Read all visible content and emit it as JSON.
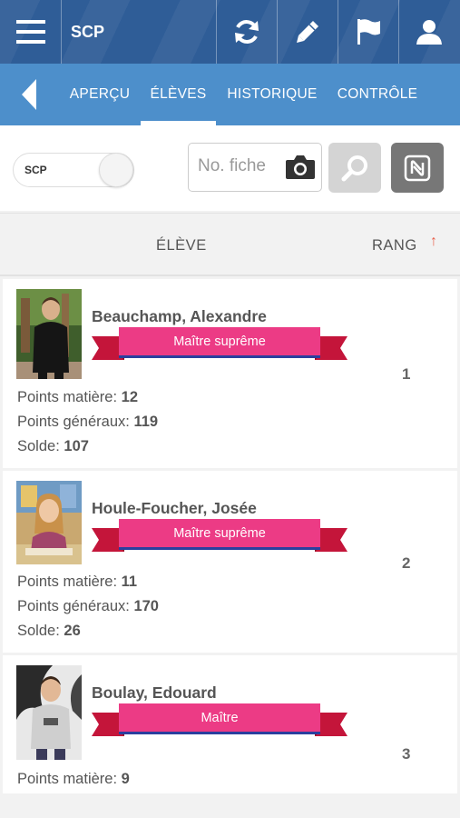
{
  "topbar": {
    "title": "SCP"
  },
  "subnav": {
    "tabs": [
      "APERÇU",
      "ÉLÈVES",
      "HISTORIQUE",
      "CONTRÔLE"
    ]
  },
  "controls": {
    "toggle_label": "SCP",
    "search_placeholder": "No. fiche"
  },
  "table": {
    "col_student": "ÉLÈVE",
    "col_rank": "RANG",
    "sort_arrow": "↑"
  },
  "labels": {
    "points_matiere": "Points matière:",
    "points_generaux": "Points généraux:",
    "solde": "Solde:"
  },
  "students": [
    {
      "name": "Beauchamp, Alexandre",
      "title": "Maître suprême",
      "points_matiere": "12",
      "points_generaux": "119",
      "solde": "107",
      "rank": "1"
    },
    {
      "name": "Houle-Foucher, Josée",
      "title": "Maître suprême",
      "points_matiere": "11",
      "points_generaux": "170",
      "solde": "26",
      "rank": "2"
    },
    {
      "name": "Boulay, Edouard",
      "title": "Maître",
      "points_matiere": "9",
      "rank": "3"
    }
  ],
  "colors": {
    "topbar": "#2f5d97",
    "subnav": "#4d8fcb",
    "ribbon_pink": "#ec3b85",
    "ribbon_dark": "#c4153a",
    "ribbon_blue": "#2a3f9e",
    "sort_arrow": "#e8604c"
  }
}
